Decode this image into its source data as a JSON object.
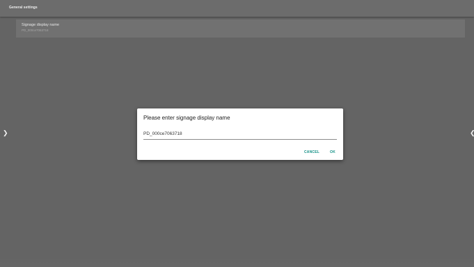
{
  "header": {
    "title": "General settings"
  },
  "settings_list": {
    "items": [
      {
        "label": "Signage display name",
        "value": "PD_000ce7063718"
      }
    ]
  },
  "nav": {
    "left_icon": "chevron-left-icon",
    "right_icon": "chevron-right-icon"
  },
  "dialog": {
    "title": "Please enter signage display name",
    "input_value": "PD_000ce7063718",
    "cancel_label": "CANCEL",
    "ok_label": "OK",
    "accent_color": "#169187"
  }
}
